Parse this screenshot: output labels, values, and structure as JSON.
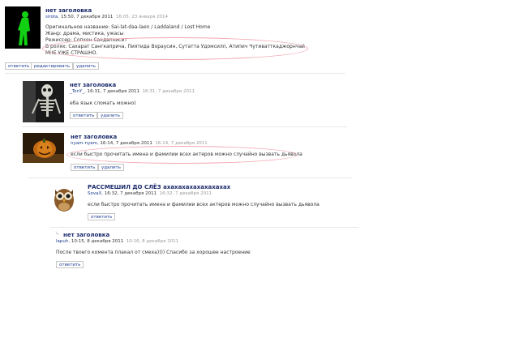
{
  "buttons": {
    "reply": "ответить",
    "edit": "редактировать",
    "delete": "удалить"
  },
  "oval_color": "#f2a6b2",
  "link_color": "#1a3c8f",
  "comments": [
    {
      "title": "нет заголовка",
      "user": "sirota",
      "date": "15:50, 7 декабря 2011",
      "edited": "16:05, 23 января 2014",
      "lines": [
        "Оригинальное название: Sai-lat-daa-laen / Laddaland / Lost Home",
        "Жанр: драма, мистика, ужасы",
        "Режиссер: Сопхон Сакдапхисит",
        "В ролях: Сахарат Сангкаприча, Пиятида Вораусин, Сутатта Удомсилп, Атипич Чутиватткаджорнчай",
        "МНЕ УЖЕ СТРАШНО."
      ],
      "avatar_icon": "green-silhouette-avatar"
    },
    {
      "title": "нет заголовка",
      "user": "_TonY_",
      "date": "16:31, 7 декабря 2011",
      "edited": "16:31, 7 декабря 2011",
      "lines": [
        "еба язык сломать можно)"
      ],
      "avatar_icon": "skeleton-avatar"
    },
    {
      "title": "нет заголовка",
      "user": "nyam-nyam",
      "date": "16:14, 7 декабря 2011",
      "edited": "16:14, 7 декабря 2011",
      "lines": [
        "если быстро прочитать имена и фамилии всех актеров можно случайно вызвать дьявола"
      ],
      "avatar_icon": "pumpkin-avatar"
    },
    {
      "title": "РАССМЕШИЛ ДО СЛЁЗ ахахахахахахахахах",
      "user": "SovaX",
      "date": "16:32, 7 декабря 2011",
      "edited": "16:32, 7 декабря 2011",
      "lines": [
        "если быстро прочитать имена и фамилии всех актеров можно случайно вызвать дьявола"
      ],
      "avatar_icon": "owl-avatar"
    },
    {
      "title": "нет заголовка",
      "user": "lapuh",
      "date": "10:15, 8 декабря 2011",
      "edited": "10:16, 8 декабря 2011",
      "lines": [
        "После твоего комента плакал от смеха)))) Спасибо за хорошее настроение"
      ],
      "avatar_icon": "pin-icon"
    }
  ]
}
